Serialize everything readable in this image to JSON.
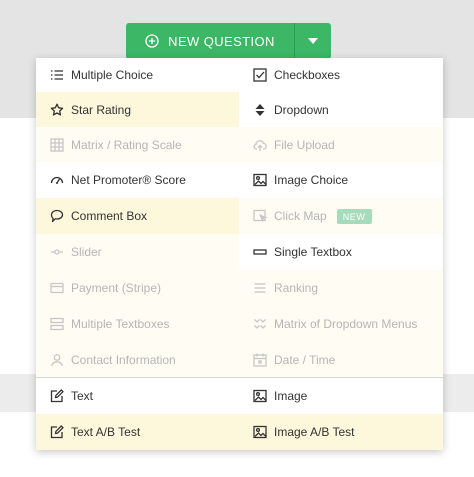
{
  "toolbar": {
    "new_question_label": "NEW QUESTION",
    "accent": "#3cb766"
  },
  "menu": {
    "left": [
      {
        "label": "Multiple Choice",
        "icon": "list-icon",
        "state": "normal"
      },
      {
        "label": "Star Rating",
        "icon": "star-icon",
        "state": "highlight"
      },
      {
        "label": "Matrix / Rating Scale",
        "icon": "grid-icon",
        "state": "faint"
      },
      {
        "label": "Net Promoter® Score",
        "icon": "gauge-icon",
        "state": "normal"
      },
      {
        "label": "Comment Box",
        "icon": "speech-bubble-icon",
        "state": "highlight"
      },
      {
        "label": "Slider",
        "icon": "slider-icon",
        "state": "faint"
      },
      {
        "label": "Payment (Stripe)",
        "icon": "credit-card-icon",
        "state": "faint"
      },
      {
        "label": "Multiple Textboxes",
        "icon": "stacked-boxes-icon",
        "state": "faint"
      },
      {
        "label": "Contact Information",
        "icon": "person-icon",
        "state": "faint"
      }
    ],
    "right": [
      {
        "label": "Checkboxes",
        "icon": "checkbox-icon",
        "state": "normal"
      },
      {
        "label": "Dropdown",
        "icon": "sort-arrows-icon",
        "state": "normal"
      },
      {
        "label": "File Upload",
        "icon": "cloud-upload-icon",
        "state": "faint"
      },
      {
        "label": "Image Choice",
        "icon": "image-icon",
        "state": "normal"
      },
      {
        "label": "Click Map",
        "icon": "click-map-icon",
        "state": "faint",
        "badge": "NEW"
      },
      {
        "label": "Single Textbox",
        "icon": "textbox-icon",
        "state": "normal"
      },
      {
        "label": "Ranking",
        "icon": "ranking-icon",
        "state": "faint"
      },
      {
        "label": "Matrix of Dropdown Menus",
        "icon": "double-chevron-icon",
        "state": "faint"
      },
      {
        "label": "Date / Time",
        "icon": "calendar-icon",
        "state": "faint"
      }
    ],
    "bottom_left": [
      {
        "label": "Text",
        "icon": "edit-icon",
        "state": "normal"
      },
      {
        "label": "Text A/B Test",
        "icon": "edit-icon",
        "state": "highlight"
      }
    ],
    "bottom_right": [
      {
        "label": "Image",
        "icon": "image-icon",
        "state": "normal"
      },
      {
        "label": "Image A/B Test",
        "icon": "image-icon",
        "state": "highlight"
      }
    ]
  }
}
